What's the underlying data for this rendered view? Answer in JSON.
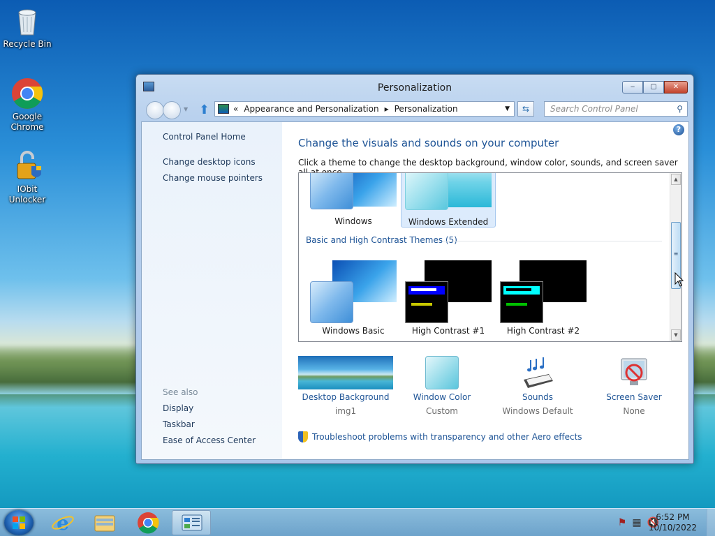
{
  "desktop": {
    "icons": [
      {
        "label": "Recycle Bin",
        "icon": "recycle-bin-icon"
      },
      {
        "label": "Google Chrome",
        "icon": "chrome-icon"
      },
      {
        "label": "IObit Unlocker",
        "icon": "iobit-unlocker-icon"
      }
    ]
  },
  "window": {
    "title": "Personalization",
    "buttons": {
      "minimize": "‒",
      "maximize": "▢",
      "close": "✕"
    }
  },
  "navbar": {
    "breadcrumb_prefix": "«",
    "breadcrumb": [
      "Appearance and Personalization",
      "Personalization"
    ],
    "breadcrumb_sep": "▸",
    "search_placeholder": "Search Control Panel"
  },
  "left_pane": {
    "home": "Control Panel Home",
    "links": [
      "Change desktop icons",
      "Change mouse pointers"
    ],
    "see_also_label": "See also",
    "see_also": [
      "Display",
      "Taskbar",
      "Ease of Access Center"
    ]
  },
  "main": {
    "heading": "Change the visuals and sounds on your computer",
    "subheading": "Click a theme to change the desktop background, window color, sounds, and screen saver all at once.",
    "aero_themes": [
      {
        "name": "Windows",
        "selected": false
      },
      {
        "name": "Windows Extended",
        "selected": true
      }
    ],
    "group_label": "Basic and High Contrast Themes (5)",
    "basic_themes": [
      {
        "name": "Windows Basic"
      },
      {
        "name": "High Contrast #1"
      },
      {
        "name": "High Contrast #2"
      }
    ],
    "settings": [
      {
        "label": "Desktop Background",
        "value": "img1",
        "icon": "desktop-background-icon"
      },
      {
        "label": "Window Color",
        "value": "Custom",
        "icon": "window-color-icon"
      },
      {
        "label": "Sounds",
        "value": "Windows Default",
        "icon": "sounds-icon"
      },
      {
        "label": "Screen Saver",
        "value": "None",
        "icon": "screen-saver-icon"
      }
    ],
    "troubleshoot": "Troubleshoot problems with transparency and other Aero effects"
  },
  "taskbar": {
    "pinned": [
      "internet-explorer-icon",
      "file-explorer-icon",
      "chrome-icon",
      "control-panel-icon"
    ],
    "clock_time": "6:52 PM",
    "clock_date": "10/10/2022"
  },
  "colors": {
    "link": "#1e5496",
    "window_frame": "#b9d1ee",
    "close_button": "#c2432c",
    "selected_theme": "#dcebfc"
  }
}
